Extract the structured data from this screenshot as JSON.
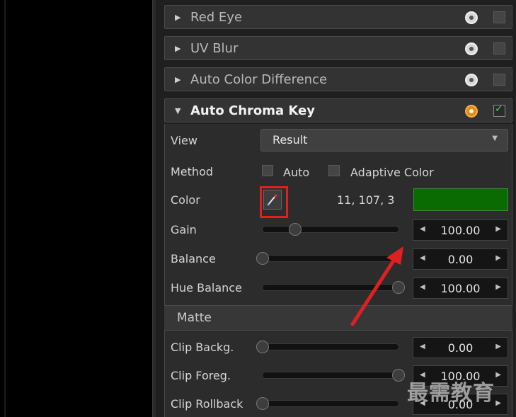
{
  "sections": [
    {
      "title": "Red Eye"
    },
    {
      "title": "UV Blur"
    },
    {
      "title": "Auto Color Difference"
    },
    {
      "title": "Auto Chroma Key"
    }
  ],
  "view": {
    "label": "View",
    "value": "Result"
  },
  "method": {
    "label": "Method",
    "auto_label": "Auto",
    "adaptive_label": "Adaptive Color"
  },
  "color": {
    "label": "Color",
    "rgb_text": "11, 107, 3",
    "swatch": "#0b6b03"
  },
  "sliders": [
    {
      "label": "Gain",
      "value": "100.00",
      "position": 0.24
    },
    {
      "label": "Balance",
      "value": "0.00",
      "position": 0.0
    },
    {
      "label": "Hue Balance",
      "value": "100.00",
      "position": 1.0
    }
  ],
  "matte": {
    "title": "Matte",
    "sliders": [
      {
        "label": "Clip Backg.",
        "value": "0.00",
        "position": 0.0
      },
      {
        "label": "Clip Foreg.",
        "value": "100.00",
        "position": 1.0
      },
      {
        "label": "Clip Rollback",
        "value": "0.00",
        "position": 0.0
      }
    ]
  },
  "watermark": "最需教育",
  "colors": {
    "annotation": "#e02020",
    "reset_active": "#e38a1c",
    "check_on": "#44d24a"
  }
}
